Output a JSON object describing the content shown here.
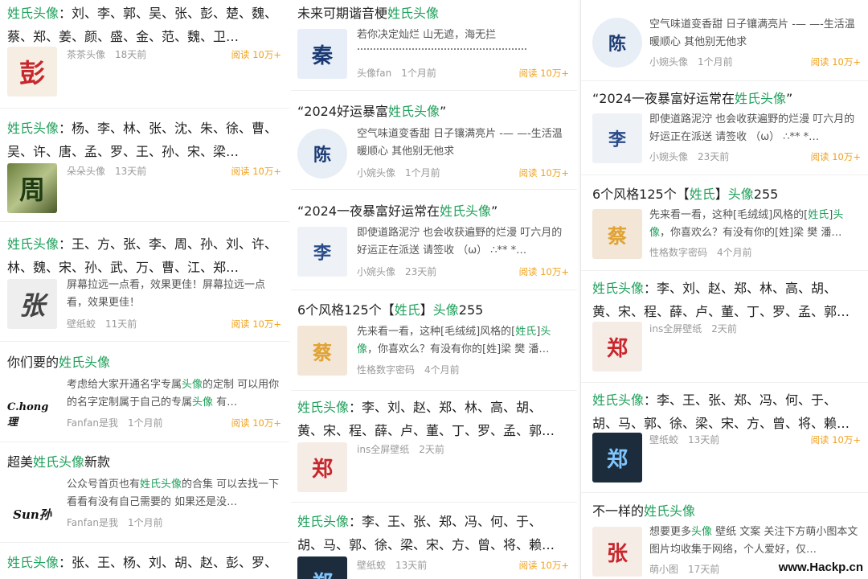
{
  "col1": {
    "cards": [
      {
        "title_hl": "姓氏头像",
        "title_rest": "：刘、李、郭、吴、张、彭、楚、魏、蔡、郑、姜、颜、盛、金、范、魏、卫…",
        "author": "茶茶头像",
        "time": "18天前",
        "read": "阅读 10万+",
        "glyph": "彭"
      },
      {
        "title_hl": "姓氏头像",
        "title_rest": "：杨、李、林、张、沈、朱、徐、曹、吴、许、唐、孟、罗、王、孙、宋、梁…",
        "author": "朵朵头像",
        "time": "13天前",
        "read": "阅读 10万+",
        "glyph": "周"
      },
      {
        "title_hl": "姓氏头像",
        "title_rest": "：王、方、张、李、周、孙、刘、许、林、魏、宋、孙、武、万、曹、江、郑…",
        "snippet": "屏幕拉远一点看，效果更佳！屏幕拉远一点看，效果更佳！",
        "author": "壁纸蛟",
        "time": "11天前",
        "read": "阅读 10万+",
        "glyph": "张"
      },
      {
        "title_pre": "你们要的",
        "title_hl": "姓氏头像",
        "snippet_a": "考虑给大家开通名字专属",
        "snippet_hl": "头像",
        "snippet_b": "的定制 可以用你的名字定制属于自己的专属",
        "snippet_hl2": "头像",
        "snippet_c": " 有…",
        "author": "Fanfan是我",
        "time": "1个月前",
        "read": "阅读 10万+",
        "glyph": "C.hong理"
      },
      {
        "title_pre": "超美",
        "title_hl": "姓氏头像",
        "title_post": "新款",
        "snippet_a": "公众号首页也有",
        "snippet_hl": "姓氏头像",
        "snippet_b": "的合集 可以去找一下看看有没有自己需要的 如果还是没…",
        "author": "Fanfan是我",
        "time": "1个月前",
        "glyph": "Sun孙"
      },
      {
        "title_hl": "姓氏头像",
        "title_rest": "：张、王、杨、刘、胡、赵、彭、罗、郭、林、唐、戴、谢、梁、孔、沈、纪…"
      }
    ]
  },
  "col2": {
    "cards": [
      {
        "title_pre": "未来可期谐音梗",
        "title_hl": "姓氏头像",
        "snippet": "若你决定灿烂 山无遮，海无拦",
        "author": "头像fan",
        "time": "1个月前",
        "read": "阅读 10万+",
        "glyph": "秦"
      },
      {
        "title_pre": "“2024好运暴富",
        "title_hl": "姓氏头像",
        "title_post": "”",
        "snippet": "空气味道变香甜 日子镶满亮片 -— —-生活温暖顺心 其他别无他求",
        "author": "小婉头像",
        "time": "1个月前",
        "read": "阅读 10万+",
        "glyph": "陈"
      },
      {
        "title_pre": "“2024一夜暴富好运常在",
        "title_hl": "姓氏头像",
        "title_post": "”",
        "snippet": "即使道路泥泞 也会收获遍野的烂漫 叮六月的好运正在派送 请签收 （ω） ∴** *…",
        "author": "小婉头像",
        "time": "23天前",
        "read": "阅读 10万+",
        "glyph": "李"
      },
      {
        "title_pre": "6个风格125个【",
        "title_hl": "姓氏",
        "title_mid": "】",
        "title_hl2": "头像",
        "title_post": "255",
        "snippet_a": "先来看一看，这种[毛绒绒]风格的[",
        "snippet_hl": "姓氏",
        "snippet_b": "]",
        "snippet_hl2": "头像",
        "snippet_c": "，你喜欢么？有没有你的[姓]梁 樊 潘…",
        "author": "性格数字密码",
        "time": "4个月前",
        "glyph": "蔡"
      },
      {
        "title_hl": "姓氏头像",
        "title_rest": "：李、刘、赵、郑、林、高、胡、黄、宋、程、薛、卢、董、丁、罗、孟、郭…",
        "author": "ins全屏壁纸",
        "time": "2天前",
        "glyph": "郑"
      },
      {
        "title_hl": "姓氏头像",
        "title_rest": "：李、王、张、郑、冯、何、于、胡、马、郭、徐、梁、宋、方、曾、将、赖…",
        "author": "壁纸蛟",
        "time": "13天前",
        "read": "阅读 10万+",
        "glyph": "郑"
      }
    ]
  },
  "col3": {
    "cards": [
      {
        "snippet": "空气味道变香甜 日子镶满亮片 -— —-生活温暖顺心 其他别无他求",
        "author": "小婉头像",
        "time": "1个月前",
        "read": "阅读 10万+",
        "glyph": "陈"
      },
      {
        "title_pre": "“2024一夜暴富好运常在",
        "title_hl": "姓氏头像",
        "title_post": "”",
        "snippet": "即使道路泥泞 也会收获遍野的烂漫 叮六月的好运正在派送 请签收 （ω） ∴** *…",
        "author": "小婉头像",
        "time": "23天前",
        "read": "阅读 10万+",
        "glyph": "李"
      },
      {
        "title_pre": "6个风格125个【",
        "title_hl": "姓氏",
        "title_mid": "】",
        "title_hl2": "头像",
        "title_post": "255",
        "snippet_a": "先来看一看，这种[毛绒绒]风格的[",
        "snippet_hl": "姓氏",
        "snippet_b": "]",
        "snippet_hl2": "头像",
        "snippet_c": "，你喜欢么？有没有你的[姓]梁 樊 潘…",
        "author": "性格数字密码",
        "time": "4个月前",
        "glyph": "蔡"
      },
      {
        "title_hl": "姓氏头像",
        "title_rest": "：李、刘、赵、郑、林、高、胡、黄、宋、程、薛、卢、董、丁、罗、孟、郭…",
        "author": "ins全屏壁纸",
        "time": "2天前",
        "glyph": "郑"
      },
      {
        "title_hl": "姓氏头像",
        "title_rest": "：李、王、张、郑、冯、何、于、胡、马、郭、徐、梁、宋、方、曾、将、赖…",
        "author": "壁纸蛟",
        "time": "13天前",
        "read": "阅读 10万+",
        "glyph": "郑"
      },
      {
        "title_pre": "不一样的",
        "title_hl": "姓氏头像",
        "snippet_a": "想要更多",
        "snippet_hl": "头像",
        "snippet_b": " 壁纸 文案 关注下方萌小图本文图片均收集于网络，个人爱好，仅…",
        "author": "萌小图",
        "time": "17天前",
        "glyph": "张"
      }
    ]
  },
  "watermark": "www.Hackp.cn",
  "colors": {
    "highlight": "#1fa05a",
    "read": "#f0a21e",
    "meta": "#9a9a9a"
  }
}
